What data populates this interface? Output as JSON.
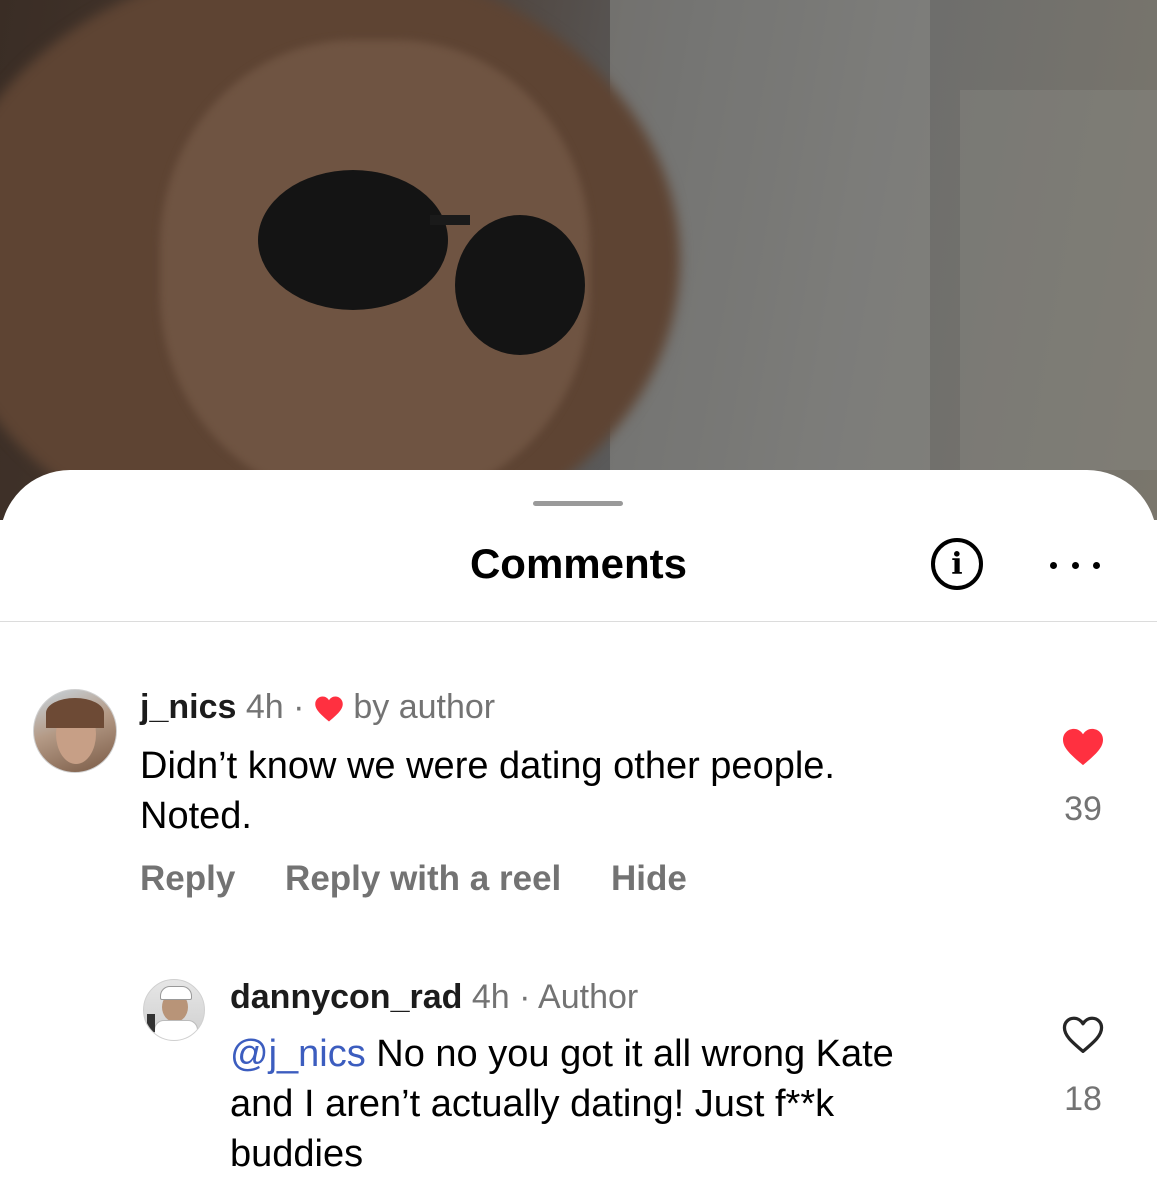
{
  "sheet": {
    "title": "Comments",
    "info_icon_glyph": "i",
    "more_icon": "more-horizontal-icon"
  },
  "comments": [
    {
      "username": "j_nics",
      "time": "4h",
      "separator": "·",
      "badge": "by author",
      "badge_icon": "heart-icon",
      "text_lines": [
        "Didn’t know we were dating other people.",
        "Noted."
      ],
      "actions": [
        "Reply",
        "Reply with a reel",
        "Hide"
      ],
      "liked": true,
      "like_color": "#ff3040",
      "likes": "39"
    },
    {
      "username": "dannycon_rad",
      "time": "4h",
      "separator": "·",
      "role": "Author",
      "mention": "@j_nics",
      "text_first_line_rest": " No no you got it all wrong Kate",
      "text_lines": [
        "and I aren’t actually dating! Just f**k",
        "buddies"
      ],
      "liked": false,
      "likes": "18"
    }
  ]
}
